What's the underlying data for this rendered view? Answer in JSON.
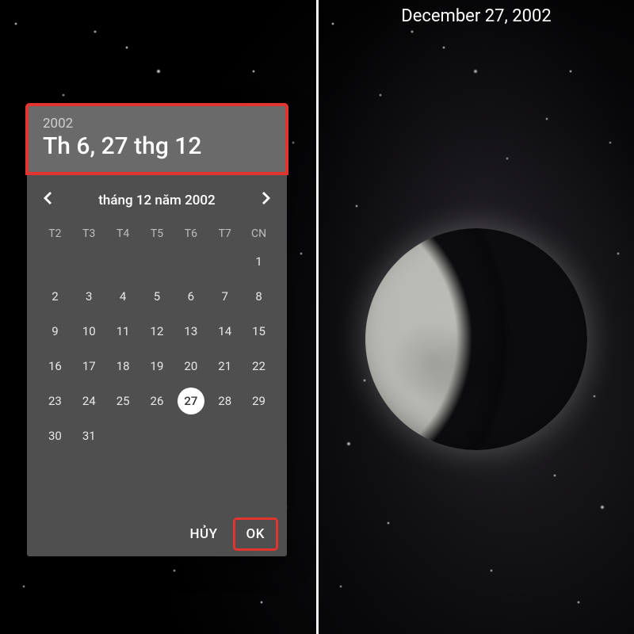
{
  "right_date_label": "December 27, 2002",
  "picker": {
    "year": "2002",
    "headline": "Th 6, 27 thg 12",
    "month_label": "tháng 12 năm 2002",
    "dow": [
      "T2",
      "T3",
      "T4",
      "T5",
      "T6",
      "T7",
      "CN"
    ],
    "first_day_index": 6,
    "days_in_month": 31,
    "selected_day": 27,
    "actions": {
      "cancel": "HỦY",
      "ok": "OK"
    }
  },
  "highlight_color": "#e3342f"
}
